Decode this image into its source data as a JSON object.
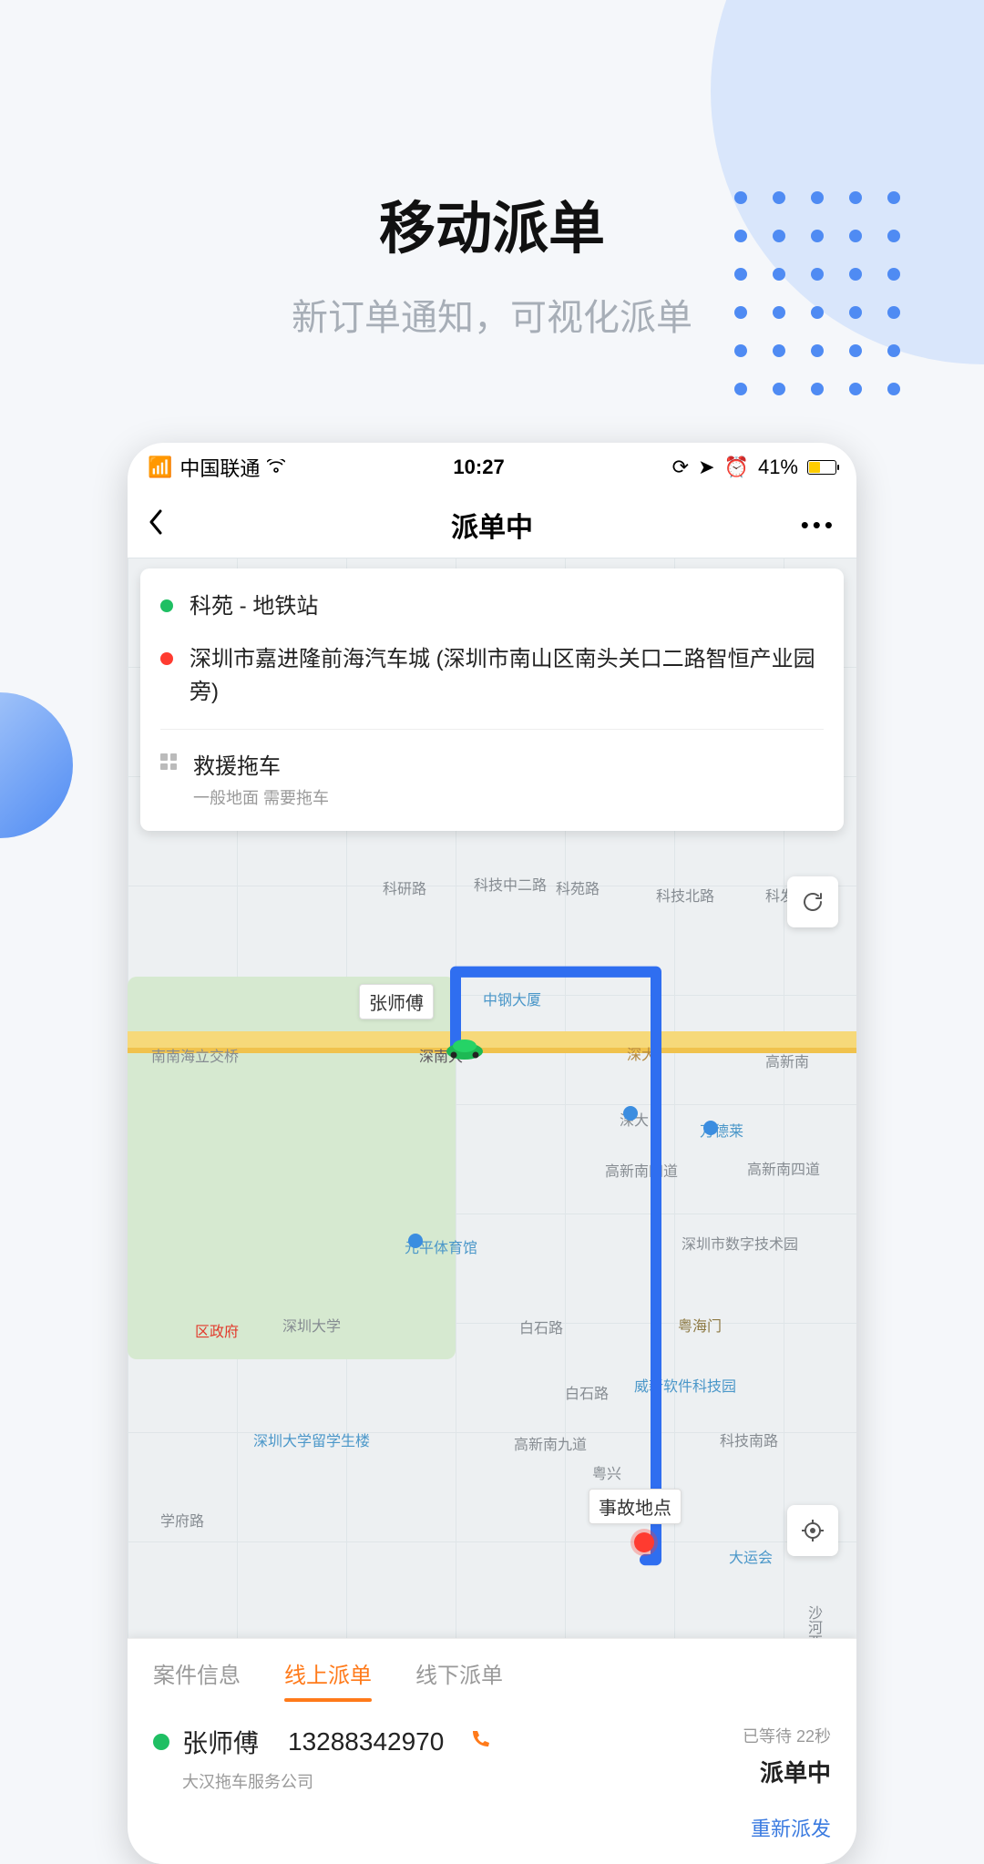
{
  "promo": {
    "title": "移动派单",
    "subtitle": "新订单通知，可视化派单"
  },
  "status_bar": {
    "carrier": "中国联通",
    "time": "10:27",
    "battery_pct": "41%"
  },
  "nav": {
    "title": "派单中",
    "more_symbol": "•••"
  },
  "info_card": {
    "origin": "科苑 - 地铁站",
    "destination": "深圳市嘉进隆前海汽车城 (深圳市南山区南头关口二路智恒产业园旁)",
    "service_title": "救援拖车",
    "service_sub": "一般地面 需要拖车"
  },
  "map_tags": {
    "driver": "张师傅",
    "accident": "事故地点"
  },
  "map_labels": {
    "l1": "科研路",
    "l2": "科技中二路",
    "l3": "科苑路",
    "l4": "科技北路",
    "l5": "科发路",
    "l6": "南南海立交桥",
    "l7": "深南大",
    "l8": "中钢大厦",
    "l9": "深大",
    "l10": "高新南",
    "l11": "深大",
    "l12": "万德莱",
    "l13": "高新南四道",
    "l14": "高新南四道",
    "l15": "元平体育馆",
    "l16": "深圳市数字技术园",
    "l17": "区政府",
    "l18": "深圳大学",
    "l19": "粤海门",
    "l20": "白石路",
    "l21": "威新软件科技园",
    "l22": "白石路",
    "l23": "深圳大学留学生楼",
    "l24": "高新南九道",
    "l25": "粤兴",
    "l26": "科技南路",
    "l27": "大运会",
    "l28": "学府路",
    "l29": "沙河西路"
  },
  "tabs": {
    "t1": "案件信息",
    "t2": "线上派单",
    "t3": "线下派单"
  },
  "sheet": {
    "driver_name": "张师傅",
    "phone": "13288342970",
    "company": "大汉拖车服务公司",
    "wait": "已等待 22秒",
    "status": "派单中",
    "reassign": "重新派发"
  }
}
